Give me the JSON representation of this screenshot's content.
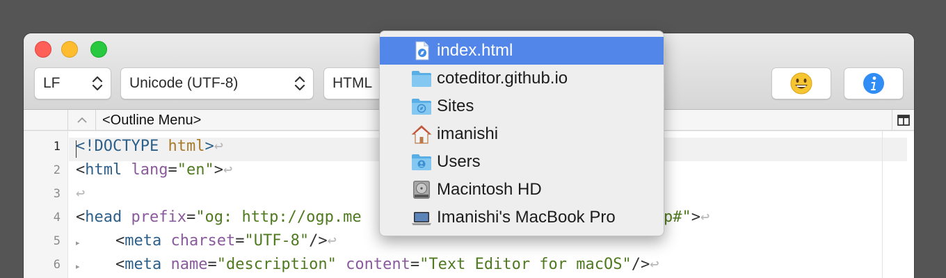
{
  "toolbar": {
    "line_ending": "LF",
    "encoding": "Unicode (UTF-8)",
    "syntax": "HTML",
    "emoji_button_icon": "smiley-face-icon",
    "info_button_icon": "info-icon"
  },
  "navbar": {
    "outline_menu": "<Outline Menu>"
  },
  "editor": {
    "current_line": 1,
    "line_numbers": [
      "1",
      "2",
      "3",
      "4",
      "5",
      "6"
    ]
  },
  "path_menu": {
    "items": [
      {
        "label": "index.html",
        "icon": "html-document-icon",
        "selected": true
      },
      {
        "label": "coteditor.github.io",
        "icon": "folder-icon",
        "selected": false
      },
      {
        "label": "Sites",
        "icon": "sites-folder-icon",
        "selected": false
      },
      {
        "label": "imanishi",
        "icon": "home-icon",
        "selected": false
      },
      {
        "label": "Users",
        "icon": "users-folder-icon",
        "selected": false
      },
      {
        "label": "Macintosh HD",
        "icon": "hard-drive-icon",
        "selected": false
      },
      {
        "label": "Imanishi's MacBook Pro",
        "icon": "laptop-icon",
        "selected": false
      }
    ]
  },
  "colors": {
    "selection": "#5286e8",
    "folder": "#6cb9ec",
    "tag": "#2c5f8a",
    "attribute": "#8a5a9c",
    "string": "#4f7a1f"
  },
  "code_lines": {
    "l1": {
      "t1": "<!DOCTYPE ",
      "t2": "html",
      "t3": ">",
      "inv": "↩"
    },
    "l2": {
      "t1": "<",
      "tag": "html",
      "sp": " ",
      "attr": "lang",
      "eq": "=",
      "str": "\"en\"",
      "t2": ">",
      "inv": "↩"
    },
    "l3": {
      "inv": "↩"
    },
    "l4": {
      "t1": "<",
      "tag": "head",
      "sp": " ",
      "attr": "prefix",
      "eq": "=",
      "str": "\"og: http://ogp.me",
      "tail_str": "p#\"",
      "t2": ">",
      "inv": "↩"
    },
    "l5": {
      "indent": "  ",
      "t1": "<",
      "tag": "meta",
      "sp": " ",
      "attr": "charset",
      "eq": "=",
      "str": "\"UTF-8\"",
      "t2": "/>",
      "inv": "↩"
    },
    "l6": {
      "indent": "  ",
      "t1": "<",
      "tag": "meta",
      "sp": " ",
      "attr": "name",
      "eq": "=",
      "str": "\"description\"",
      "sp2": " ",
      "attr2": "content",
      "eq2": "=",
      "str2": "\"Text Editor for macOS\"",
      "t2": "/>",
      "inv": "↩"
    }
  }
}
